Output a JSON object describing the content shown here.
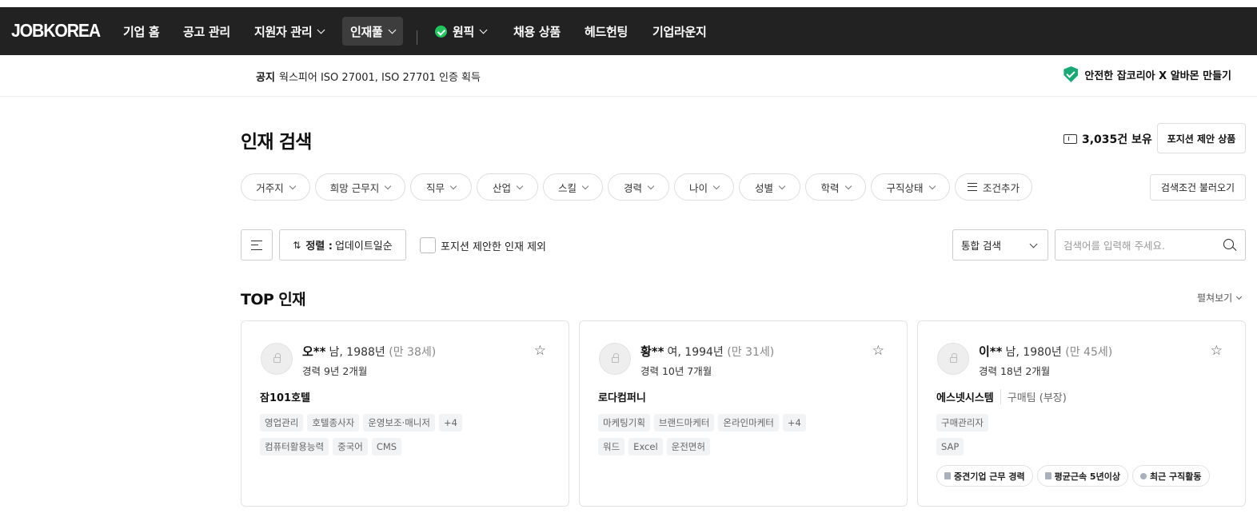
{
  "nav": {
    "logo": "JOBKOREA",
    "items": [
      {
        "label": "기업 홈"
      },
      {
        "label": "공고 관리"
      },
      {
        "label": "지원자 관리"
      },
      {
        "label": "인재풀"
      },
      {
        "label": "원픽"
      },
      {
        "label": "채용 상품"
      },
      {
        "label": "헤드헌팅"
      },
      {
        "label": "기업라운지"
      }
    ]
  },
  "notice": {
    "label": "공지",
    "text": "웍스피어 ISO 27001, ISO 27701 인증 획득",
    "safe_link": "안전한 잡코리아 X 알바몬 만들기"
  },
  "page": {
    "title": "인재 검색",
    "owned": "3,035건 보유",
    "position_offer_product": "포지션 제안 상품"
  },
  "filters": {
    "chips": [
      "거주지",
      "희망 근무지",
      "직무",
      "산업",
      "스킬",
      "경력",
      "나이",
      "성별",
      "학력",
      "구직상태"
    ],
    "add_condition": "조건추가",
    "load_conditions": "검색조건 불러오기"
  },
  "toolbar": {
    "sort_label": "정렬 :",
    "sort_value": "업데이트일순",
    "exclude_checkbox": "포지션 제안한 인재 제외",
    "search_type": "통합 검색",
    "search_placeholder": "검색어를 입력해 주세요."
  },
  "top": {
    "title": "TOP 인재",
    "expand": "펼쳐보기",
    "cards": [
      {
        "name": "오**",
        "info": "남, 1988년",
        "age": "(만 38세)",
        "experience": "경력 9년 2개월",
        "company": "잠101호텔",
        "team": "",
        "jobs": [
          "영업관리",
          "호텔종사자",
          "운영보조·매니저",
          "+4"
        ],
        "skills": [
          "컴퓨터활용능력",
          "중국어",
          "CMS"
        ],
        "badges": []
      },
      {
        "name": "황**",
        "info": "여, 1994년",
        "age": "(만 31세)",
        "experience": "경력 10년 7개월",
        "company": "로다컴퍼니",
        "team": "",
        "jobs": [
          "마케팅기획",
          "브랜드마케터",
          "온라인마케터",
          "+4"
        ],
        "skills": [
          "워드",
          "Excel",
          "운전면허"
        ],
        "badges": []
      },
      {
        "name": "이**",
        "info": "남, 1980년",
        "age": "(만 45세)",
        "experience": "경력 18년 2개월",
        "company": "에스넷시스템",
        "team": "구매팀 (부장)",
        "jobs": [
          "구매관리자"
        ],
        "skills": [
          "SAP"
        ],
        "badges": [
          "중견기업 근무 경력",
          "평균근속 5년이상",
          "최근 구직활동"
        ]
      }
    ]
  },
  "colors": {
    "nav_bg": "#222222",
    "accent_green": "#22c55e",
    "shield_green": "#19a974"
  }
}
